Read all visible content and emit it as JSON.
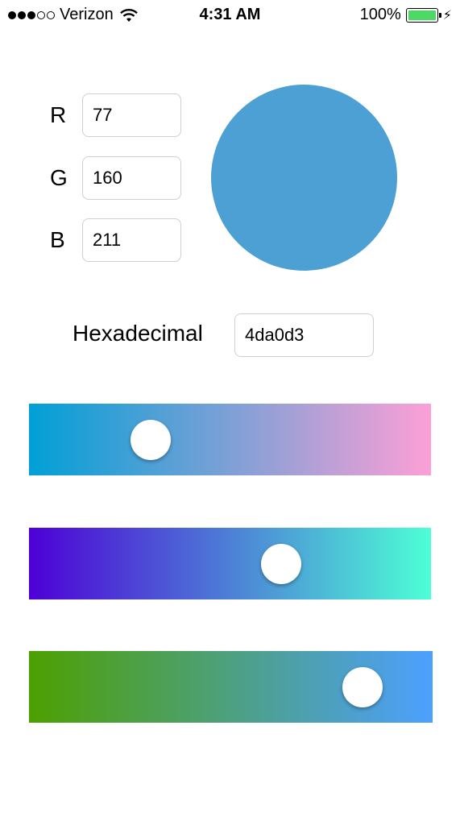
{
  "status_bar": {
    "carrier": "Verizon",
    "time": "4:31 AM",
    "battery_percent": "100%"
  },
  "color": {
    "r_label": "R",
    "g_label": "G",
    "b_label": "B",
    "r_value": "77",
    "g_value": "160",
    "b_value": "211",
    "swatch_hex": "#4da0d3"
  },
  "hex": {
    "label": "Hexadecimal",
    "value": "4da0d3"
  },
  "sliders": [
    {
      "name": "red",
      "from": "#00a0d6",
      "to": "#fca0d6",
      "value_fraction": 0.302
    },
    {
      "name": "green",
      "from": "#4d00d6",
      "to": "#4dffd6",
      "value_fraction": 0.627
    },
    {
      "name": "blue",
      "from": "#4da000",
      "to": "#4da0ff",
      "value_fraction": 0.827
    }
  ]
}
